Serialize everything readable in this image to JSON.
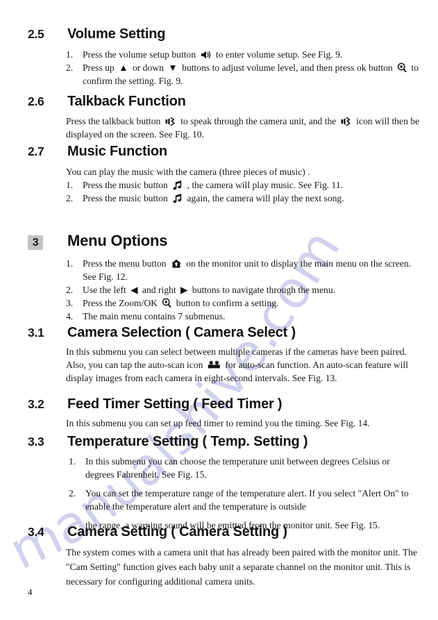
{
  "document": {
    "page_number": "4",
    "watermark_text": "manualshive.com"
  },
  "sections": [
    {
      "number": "2.5",
      "title": "Volume Setting",
      "items": [
        {
          "marker": "1.",
          "parts": [
            "Press the volume setup button ",
            "speaker-volume-icon",
            " to enter volume setup. See Fig. 9."
          ]
        },
        {
          "marker": "2.",
          "parts": [
            "Press up ",
            "triangle-up-icon",
            " or down ",
            "triangle-down-icon",
            " buttons to adjust volume level, and then press ok button ",
            "zoom-ok-magnifier-icon",
            " to confirm the setting. Fig. 9."
          ]
        }
      ]
    },
    {
      "number": "2.6",
      "title": "Talkback Function",
      "paragraph_parts": [
        "Press the talkback button ",
        "talkback-icon",
        " to speak through the camera unit, and the ",
        "talkback-icon",
        " icon will then be displayed on the screen. See Fig. 10."
      ]
    },
    {
      "number": "2.7",
      "title": "Music Function",
      "intro": "You can play the music with the camera (three pieces of music) .",
      "items": [
        {
          "marker": "1.",
          "parts": [
            "Press the music button ",
            "music-note-icon",
            " , the camera will play music. See Fig. 11."
          ]
        },
        {
          "marker": "2.",
          "parts": [
            "Press the music button ",
            "music-note-icon",
            " again, the camera will play the next song."
          ]
        }
      ]
    },
    {
      "number": "3",
      "boxed": true,
      "title": "Menu Options",
      "items": [
        {
          "marker": "1.",
          "parts": [
            "Press the menu button ",
            "home-menu-icon",
            " on the monitor unit to display the main menu on the screen. See Fig. 12."
          ]
        },
        {
          "marker": "2.",
          "parts": [
            "Use the left ",
            "triangle-left-icon",
            " and right ",
            "triangle-right-icon",
            " buttons to navigate through the menu."
          ]
        },
        {
          "marker": "3.",
          "parts": [
            "Press the Zoom/OK ",
            "zoom-ok-magnifier-icon",
            " button to confirm a setting."
          ]
        },
        {
          "marker": "4.",
          "parts": [
            "The main menu contains 7 submenus."
          ]
        }
      ]
    },
    {
      "number": "3.1",
      "title": "Camera Selection ( Camera Select )",
      "paragraph_parts": [
        "In this submenu you can select between multiple cameras if the cameras have been paired. Also, you can tap the auto-scan icon ",
        "auto-scan-camera-icon",
        " for auto-scan function. An auto-scan feature will display images from each camera in eight-second intervals. See Fig. 13."
      ]
    },
    {
      "number": "3.2",
      "title": "Feed Timer Setting ( Feed Timer )",
      "paragraph": "In this submenu you can set up feed timer to remind you the timing. See Fig. 14."
    },
    {
      "number": "3.3",
      "title": "Temperature Setting ( Temp. Setting )",
      "items": [
        {
          "marker": "1.",
          "parts": [
            "In this submenu you can choose the temperature unit between degrees Celsius or degrees Fahrenheit. See Fig. 15."
          ]
        },
        {
          "marker": "2.",
          "parts": [
            "You can set the temperature range of the temperature alert. If you select  \"Alert On\" to enable the temperature alert and the temperature is outside"
          ]
        },
        {
          "marker": "",
          "parts": [
            "the range, a warning sound will be emitted from the monitor unit. See Fig. 15."
          ]
        }
      ]
    },
    {
      "number": "3.4",
      "title": "Camera Setting ( Camera Setting )",
      "paragraph": "The system comes with a camera unit that has already been paired with the monitor unit. The \"Cam Setting\" function gives each baby unit a separate channel on the monitor unit. This is necessary for configuring additional camera units."
    }
  ]
}
